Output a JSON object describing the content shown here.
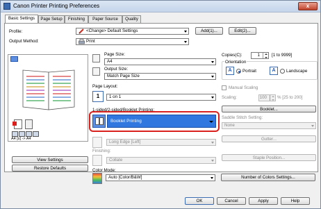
{
  "window": {
    "title": "Canon Printer Printing Preferences",
    "close_label": "x"
  },
  "tabs": [
    "Basic Settings",
    "Page Setup",
    "Finishing",
    "Paper Source",
    "Quality"
  ],
  "profile": {
    "label": "Profile:",
    "value": "<Change> Default Settings",
    "add_label": "Add(1)...",
    "edit_label": "Edit(2)..."
  },
  "output": {
    "label": "Output Method:",
    "value": "Print"
  },
  "preview": {
    "caption": "A4 [s] -> A4"
  },
  "left_buttons": {
    "view_settings": "View Settings",
    "restore_defaults": "Restore Defaults"
  },
  "page_size": {
    "label": "Page Size:",
    "value": "A4"
  },
  "output_size": {
    "label": "Output Size:",
    "value": "Match Page Size"
  },
  "page_layout": {
    "label": "Page Layout:",
    "number": "1",
    "value": "1 on 1"
  },
  "booklet": {
    "label": "1-sided/2-sided/Booklet Printing:",
    "value": "Booklet Printing"
  },
  "binding": {
    "value": "Long Edge [Left]"
  },
  "finishing": {
    "label": "Finishing:",
    "value": "Collate"
  },
  "color_mode": {
    "label": "Color Mode:",
    "value": "Auto [Color/B&W]"
  },
  "copies": {
    "label": "Copies(C):",
    "value": "1",
    "range": "[1 to 9999]"
  },
  "orientation": {
    "label": "Orientation",
    "portrait": "Portrait",
    "landscape": "Landscape",
    "selected": "Portrait"
  },
  "manual_scaling": {
    "label": "Manual Scaling"
  },
  "scaling": {
    "label": "Scaling:",
    "value": "100",
    "range": "% [25 to 200]"
  },
  "right_buttons": {
    "booklet": "Booklet...",
    "gutter": "Gutter...",
    "staple_position": "Staple Position...",
    "number_of_colors": "Number of Colors Settings..."
  },
  "saddle_stitch": {
    "label": "Saddle Stitch Setting:",
    "value": "None"
  },
  "footer": {
    "ok": "OK",
    "cancel": "Cancel",
    "apply": "Apply",
    "help": "Help"
  },
  "colors": {
    "highlight": "#3177e0",
    "callout": "#d9201d",
    "titlebar": "#c4d4ea"
  }
}
